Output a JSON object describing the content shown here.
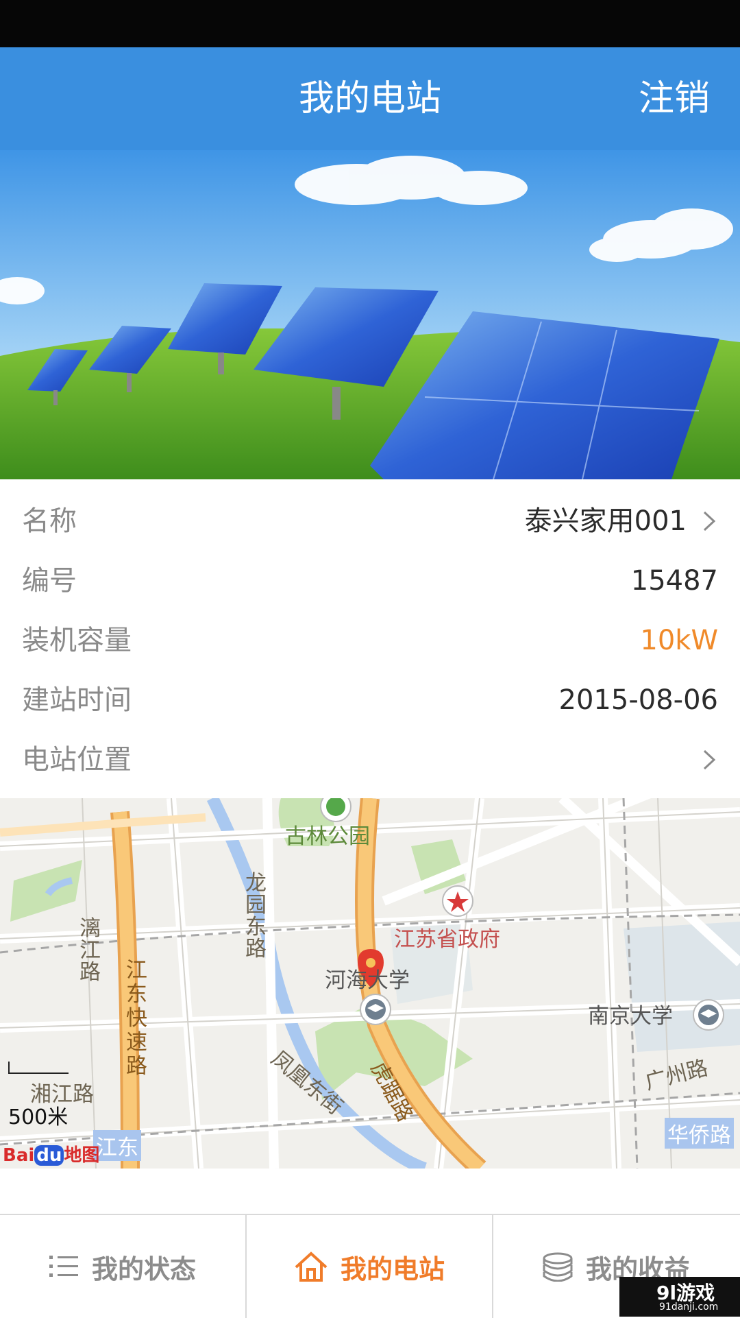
{
  "header": {
    "title": "我的电站",
    "logout_label": "注销"
  },
  "station": {
    "rows": [
      {
        "label": "名称",
        "value": "泰兴家用001"
      },
      {
        "label": "编号",
        "value": "15487"
      },
      {
        "label": "装机容量",
        "value": "10kW"
      },
      {
        "label": "建站时间",
        "value": "2015-08-06"
      },
      {
        "label": "电站位置",
        "value": ""
      }
    ]
  },
  "map": {
    "labels": {
      "gulin_park": "古林公园",
      "jiangsu_gov": "江苏省政府",
      "hohai_univ": "河海大学",
      "nanjing_univ": "南京大学",
      "guangzhou_rd": "广州路",
      "huaqiao_rd": "华侨路",
      "longyuan_rd": "龙园东路",
      "lijiang_rd": "漓江路",
      "jiangdong_expressway": "江东快速路",
      "fenghuang_st": "凤凰东街",
      "huju_rd": "虎踞路",
      "xiangjiang_rd": "湘江路",
      "jiangdong": "江东"
    },
    "scale": "500米",
    "brand": {
      "bai": "Bai",
      "du": "du",
      "ditu": "地图"
    }
  },
  "tabs": [
    {
      "label": "我的状态",
      "icon": "list-icon",
      "active": false
    },
    {
      "label": "我的电站",
      "icon": "home-icon",
      "active": true
    },
    {
      "label": "我的收益",
      "icon": "coins-icon",
      "active": false
    }
  ],
  "watermark": {
    "logo": "9l游戏",
    "site": "91danji.com"
  },
  "colors": {
    "header_blue": "#3a8fdf",
    "accent_orange": "#f07c2a",
    "value_orange": "#f08a2a"
  }
}
